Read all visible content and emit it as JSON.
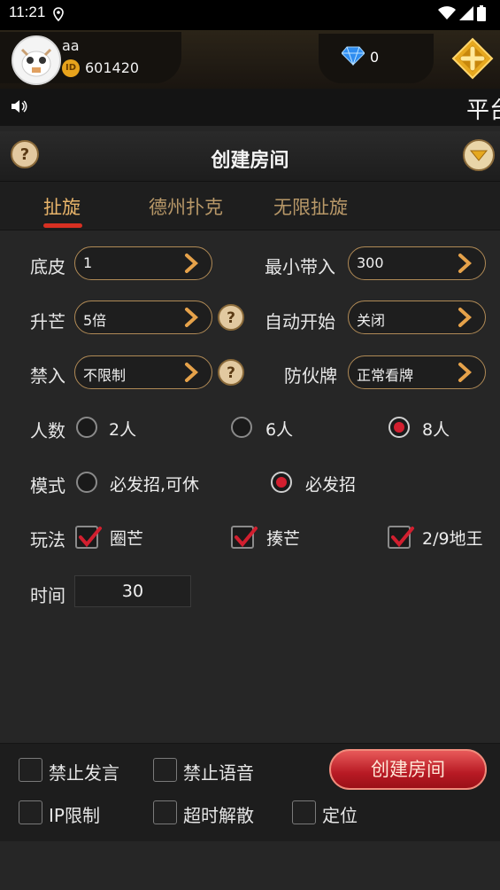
{
  "status_bar": {
    "time": "11:21"
  },
  "user": {
    "name": "aa",
    "id_badge": "ID",
    "id": "601420"
  },
  "gems": {
    "count": "0"
  },
  "marquee": {
    "text": "平台"
  },
  "title": "创建房间",
  "tabs": [
    {
      "label": "扯旋",
      "active": true
    },
    {
      "label": "德州扑克",
      "active": false
    },
    {
      "label": "无限扯旋",
      "active": false
    }
  ],
  "form": {
    "base": {
      "label": "底皮",
      "value": "1"
    },
    "min_buyin": {
      "label": "最小带入",
      "value": "300"
    },
    "raise": {
      "label": "升芒",
      "value": "5倍"
    },
    "auto_start": {
      "label": "自动开始",
      "value": "关闭"
    },
    "ban_join": {
      "label": "禁入",
      "value": "不限制"
    },
    "anti_collusion": {
      "label": "防伙牌",
      "value": "正常看牌"
    },
    "players": {
      "label": "人数",
      "options": [
        "2人",
        "6人",
        "8人"
      ],
      "selected": "8人"
    },
    "mode": {
      "label": "模式",
      "options": [
        "必发招,可休",
        "必发招"
      ],
      "selected": "必发招"
    },
    "rules": {
      "label": "玩法",
      "options": [
        {
          "label": "圈芒",
          "checked": true
        },
        {
          "label": "揍芒",
          "checked": true
        },
        {
          "label": "2/9地王",
          "checked": true
        }
      ]
    },
    "time": {
      "label": "时间",
      "value": "30"
    }
  },
  "bottom": {
    "options": [
      {
        "label": "禁止发言",
        "checked": false
      },
      {
        "label": "禁止语音",
        "checked": false
      },
      {
        "label": "IP限制",
        "checked": false
      },
      {
        "label": "超时解散",
        "checked": false
      },
      {
        "label": "定位",
        "checked": false
      }
    ],
    "create_button": "创建房间"
  },
  "colors": {
    "accent": "#d21f2f",
    "gold_border": "#b08a56",
    "tab_active": "#e8b46a",
    "tab_inactive": "#b89868"
  }
}
